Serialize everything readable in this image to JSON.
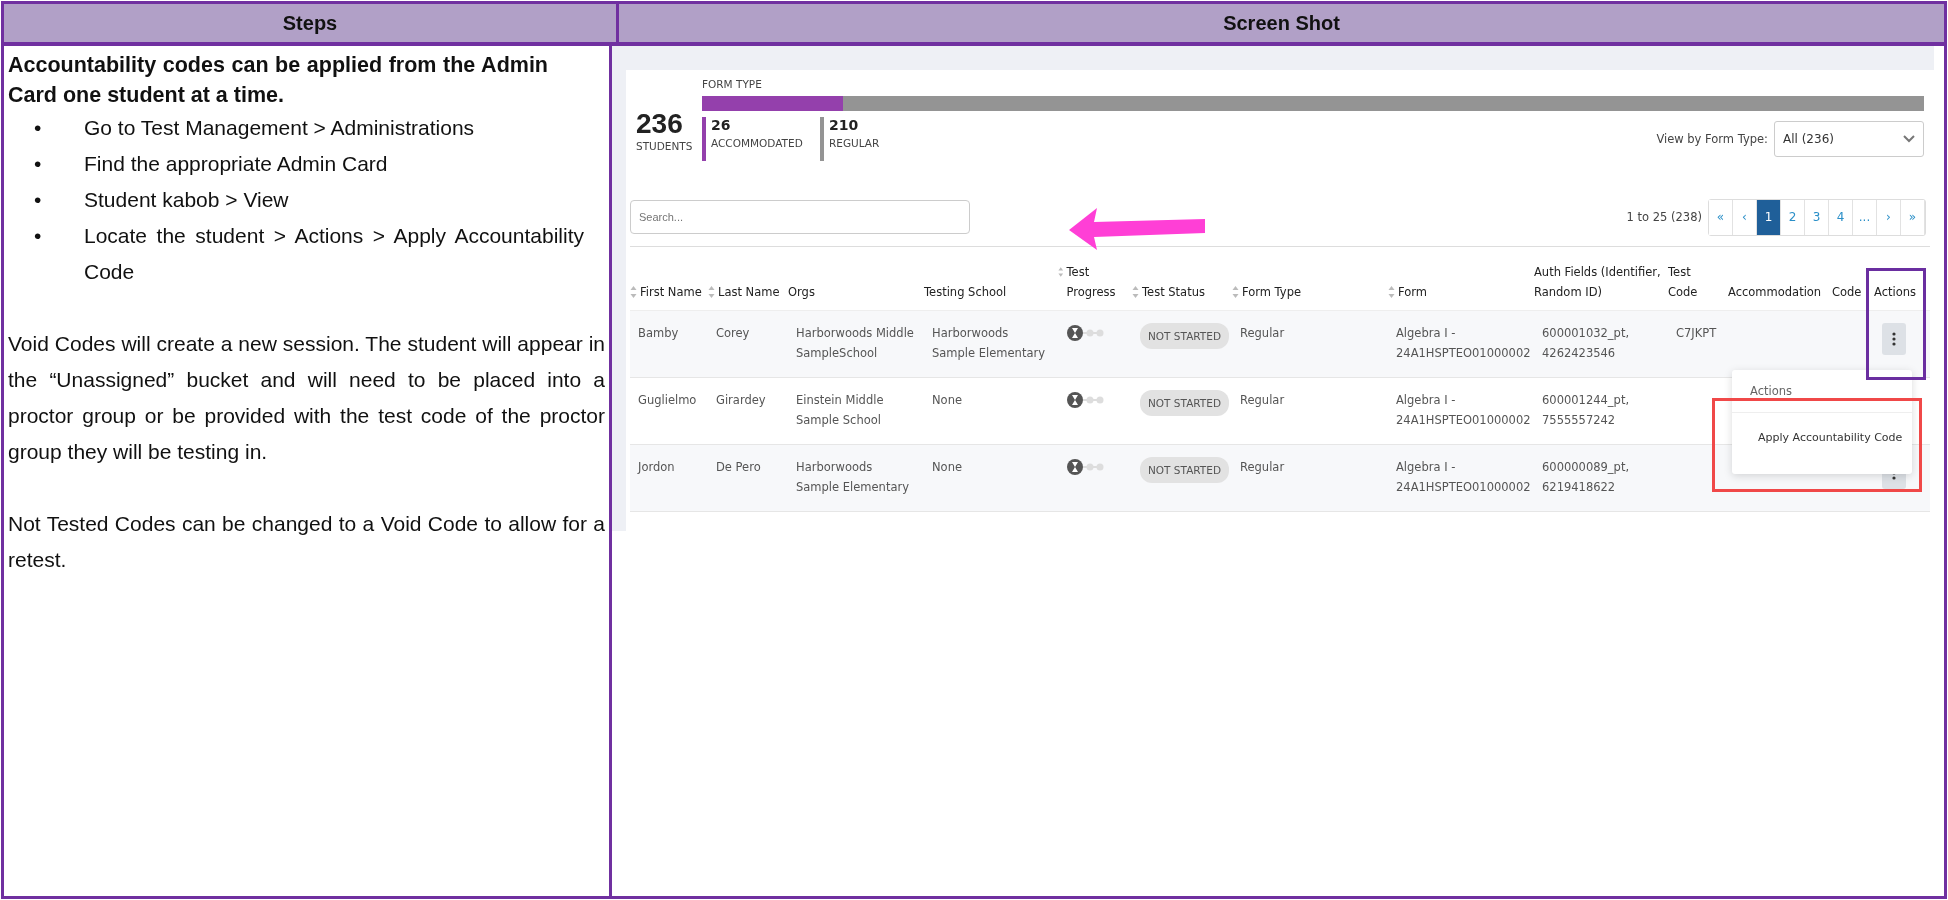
{
  "table_headers": [
    "Steps",
    "Screen Shot"
  ],
  "steps": {
    "heading": "Accountability codes can be applied from the Admin Card one student at a time.",
    "bullets": [
      {
        "marker": "•",
        "text": "Go to Test Management > Administrations"
      },
      {
        "marker": "•",
        "text": "Find the appropriate Admin Card"
      },
      {
        "marker": "•",
        "text": "Student kabob > View"
      },
      {
        "marker": "•",
        "text": "Locate the student > Actions > Apply Accountability Code"
      }
    ],
    "paragraphs": [
      "Void Codes will create a new session. The student will appear in the “Unassigned” bucket and will need to be placed into a proctor group or be provided with the test code of the proctor group they will be testing in.",
      "Not Tested Codes can be changed to a Void Code to allow for a retest."
    ]
  },
  "screenshot": {
    "total": {
      "value": "236",
      "label": "STUDENTS"
    },
    "form_type": {
      "title": "FORM TYPE",
      "level": 0.115,
      "groups": [
        {
          "value": "26",
          "label": "ACCOMMODATED",
          "color": "#9440ac"
        },
        {
          "value": "210",
          "label": "REGULAR",
          "color": "#949494"
        }
      ]
    },
    "view_by": {
      "label": "View by Form Type:",
      "value": "All (236)"
    },
    "search": {
      "placeholder": "Search..."
    },
    "range": "1 to 25 (238)",
    "pages": [
      {
        "label": "«",
        "selected": false
      },
      {
        "label": "‹",
        "selected": false
      },
      {
        "label": "1",
        "selected": true
      },
      {
        "label": "2",
        "selected": false
      },
      {
        "label": "3",
        "selected": false
      },
      {
        "label": "4",
        "selected": false
      },
      {
        "label": "...",
        "selected": false
      },
      {
        "label": "›",
        "selected": false
      },
      {
        "label": "»",
        "selected": false
      }
    ],
    "columns": [
      {
        "label": "First Name",
        "sortable": true
      },
      {
        "label": "Last Name",
        "sortable": true
      },
      {
        "label": "Orgs",
        "sortable": false
      },
      {
        "label": "Testing School",
        "sortable": false
      },
      {
        "label": "Test Progress",
        "sortable": true
      },
      {
        "label": "Test Status",
        "sortable": true
      },
      {
        "label": "Form Type",
        "sortable": true
      },
      {
        "label": "Form",
        "sortable": true
      },
      {
        "label": "Auth Fields (Identifier, Random ID)",
        "sortable": false
      },
      {
        "label": "Test Code",
        "sortable": false
      },
      {
        "label": "Accommodation",
        "sortable": false
      },
      {
        "label": "Code",
        "sortable": false
      },
      {
        "label": "Actions",
        "sortable": false
      }
    ],
    "rows": [
      {
        "first": "Bamby",
        "last": "Corey",
        "orgs": "Harborwoods Middle SampleSchool",
        "school": "Harborwoods Sample Elementary",
        "status": "NOT STARTED",
        "form_type": "Regular",
        "form": "Algebra I - 24A1HSPTEO01000002",
        "auth": "600001032_pt, 4262423546",
        "test_code": "C7JKPT"
      },
      {
        "first": "Guglielmo",
        "last": "Girardey",
        "orgs": "Einstein Middle Sample School",
        "school": "None",
        "status": "NOT STARTED",
        "form_type": "Regular",
        "form": "Algebra I - 24A1HSPTEO01000002",
        "auth": "600001244_pt, 7555557242"
      },
      {
        "first": "Jordon",
        "last": "De Pero",
        "orgs": "Harborwoods Sample Elementary",
        "school": "None",
        "status": "NOT STARTED",
        "form_type": "Regular",
        "form": "Algebra I - 24A1HSPTEO01000002",
        "auth": "600000089_pt, 6219418622"
      }
    ],
    "menu": {
      "title": "Actions",
      "items": [
        "Apply Accountability Code"
      ]
    }
  }
}
